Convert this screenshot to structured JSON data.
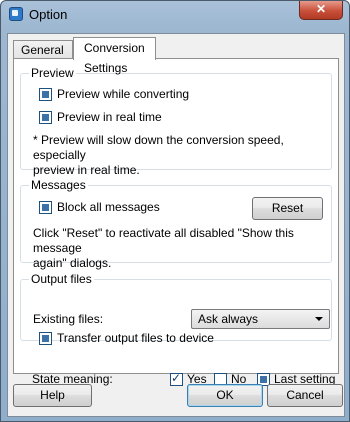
{
  "window": {
    "title": "Option",
    "close_glyph": "✕"
  },
  "tabs": [
    {
      "label": "General",
      "selected": false
    },
    {
      "label": "Conversion Settings",
      "selected": true
    }
  ],
  "preview": {
    "title": "Preview",
    "items": [
      {
        "label": "Preview while converting",
        "checked": true
      },
      {
        "label": "Preview in real time",
        "checked": true
      }
    ],
    "note_line1": "* Preview will slow down the conversion speed, especially",
    "note_line2": "preview in real time."
  },
  "messages": {
    "title": "Messages",
    "block_label": "Block all messages",
    "block_checked": true,
    "reset_label": "Reset",
    "note_line1": "Click \"Reset\" to reactivate all disabled \"Show this message",
    "note_line2": "again\" dialogs."
  },
  "output": {
    "title": "Output files",
    "existing_label": "Existing files:",
    "existing_value": "Ask always",
    "transfer_label": "Transfer output files to device",
    "transfer_checked": true
  },
  "state_meaning": {
    "label": "State meaning:",
    "yes_label": "Yes",
    "no_label": "No",
    "last_label": "Last setting"
  },
  "footer": {
    "help_label": "Help",
    "ok_label": "OK",
    "cancel_label": "Cancel"
  },
  "colors": {
    "title_bar": "#9db7d1",
    "close_button": "#c9503a",
    "check_fill": "#3c72a8"
  }
}
